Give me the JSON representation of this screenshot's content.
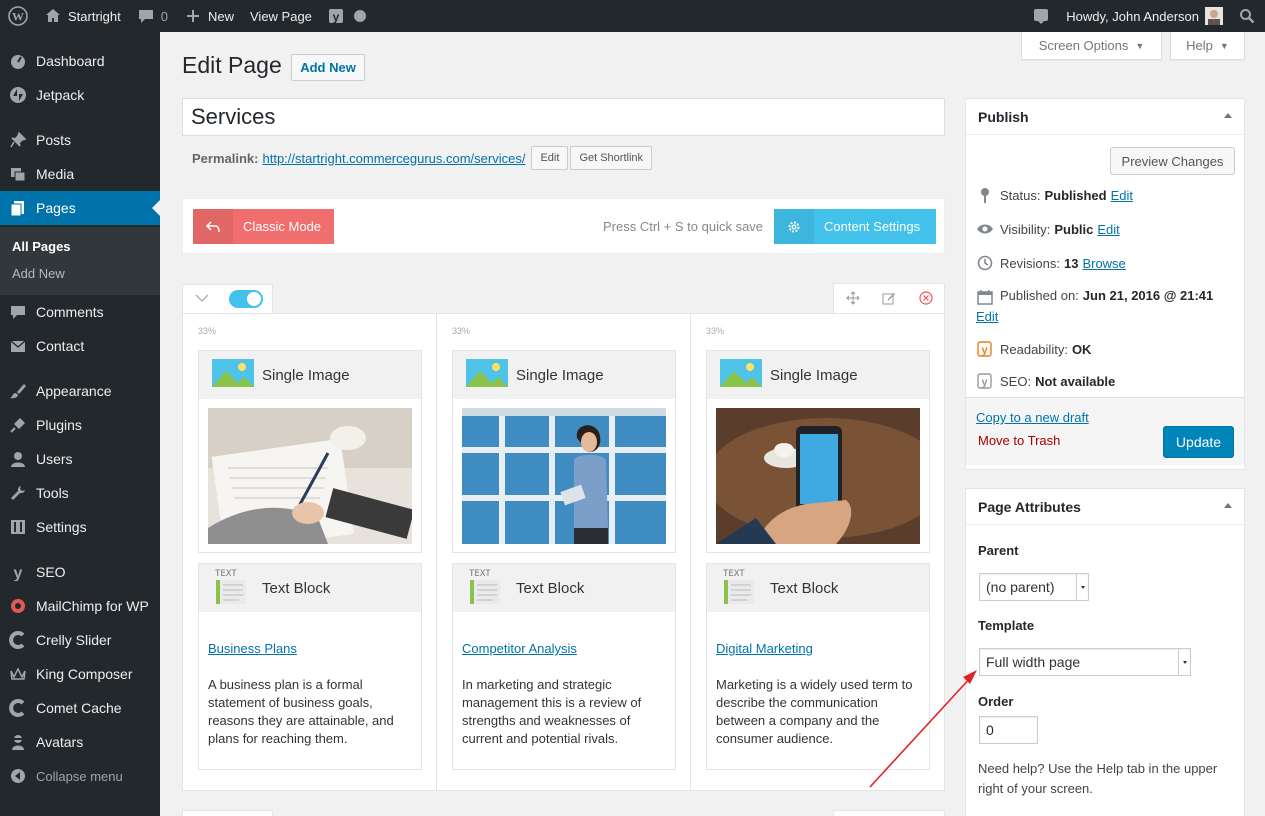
{
  "adminbar": {
    "site_name": "Startright",
    "comments_count": "0",
    "new_label": "New",
    "view_page": "View Page",
    "howdy": "Howdy, John Anderson"
  },
  "sidebar": {
    "items": [
      {
        "label": "Dashboard",
        "icon": "dashboard-icon"
      },
      {
        "label": "Jetpack",
        "icon": "jetpack-icon"
      },
      {
        "label": "Posts",
        "icon": "pin-icon"
      },
      {
        "label": "Media",
        "icon": "media-icon"
      },
      {
        "label": "Pages",
        "icon": "pages-icon"
      },
      {
        "label": "Comments",
        "icon": "comment-icon"
      },
      {
        "label": "Contact",
        "icon": "mail-icon"
      },
      {
        "label": "Appearance",
        "icon": "brush-icon"
      },
      {
        "label": "Plugins",
        "icon": "plugin-icon"
      },
      {
        "label": "Users",
        "icon": "user-icon"
      },
      {
        "label": "Tools",
        "icon": "wrench-icon"
      },
      {
        "label": "Settings",
        "icon": "settings-icon"
      },
      {
        "label": "SEO",
        "icon": "yoast-icon"
      },
      {
        "label": "MailChimp for WP",
        "icon": "mailchimp-icon"
      },
      {
        "label": "Crelly Slider",
        "icon": "slider-icon"
      },
      {
        "label": "King Composer",
        "icon": "crown-icon"
      },
      {
        "label": "Comet Cache",
        "icon": "comet-icon"
      },
      {
        "label": "Avatars",
        "icon": "avatar-icon"
      },
      {
        "label": "Collapse menu",
        "icon": "collapse-icon"
      }
    ],
    "submenu": {
      "all_pages": "All Pages",
      "add_new": "Add New"
    }
  },
  "screen_options": "Screen Options",
  "help": "Help",
  "page": {
    "heading": "Edit Page",
    "add_new": "Add New",
    "title": "Services",
    "permalink_label": "Permalink:",
    "permalink_url": "http://startright.commercegurus.com/services/",
    "edit_btn": "Edit",
    "shortlink_btn": "Get Shortlink"
  },
  "composer": {
    "classic_mode": "Classic Mode",
    "quick_save": "Press Ctrl + S to quick save",
    "content_settings": "Content Settings",
    "columns": [
      {
        "width": "33%",
        "image_label": "Single Image",
        "text_label": "Text Block",
        "link": "Business Plans",
        "text": "A business plan is a formal statement of business goals, reasons they are attainable, and plans for reaching them."
      },
      {
        "width": "33%",
        "image_label": "Single Image",
        "text_label": "Text Block",
        "link": "Competitor Analysis",
        "text": "In marketing and strategic management this is a review of strengths and weaknesses of current and potential rivals."
      },
      {
        "width": "33%",
        "image_label": "Single Image",
        "text_label": "Text Block",
        "link": "Digital Marketing",
        "text": "Marketing is a widely used term to describe the communication between a company and the consumer audience."
      }
    ]
  },
  "publish": {
    "title": "Publish",
    "preview": "Preview Changes",
    "status_label": "Status:",
    "status_value": "Published",
    "visibility_label": "Visibility:",
    "visibility_value": "Public",
    "revisions_label": "Revisions:",
    "revisions_value": "13",
    "browse": "Browse",
    "published_label": "Published on:",
    "published_value": "Jun 21, 2016 @ 21:41",
    "edit": "Edit",
    "readability_label": "Readability:",
    "readability_value": "OK",
    "seo_label": "SEO:",
    "seo_value": "Not available",
    "copy_draft": "Copy to a new draft",
    "trash": "Move to Trash",
    "update": "Update"
  },
  "attributes": {
    "title": "Page Attributes",
    "parent_label": "Parent",
    "parent_value": "(no parent)",
    "template_label": "Template",
    "template_value": "Full width page",
    "order_label": "Order",
    "order_value": "0",
    "help": "Need help? Use the Help tab in the upper right of your screen."
  },
  "colors": {
    "wp_blue": "#0073aa",
    "admin_dark": "#23282d",
    "classic_red": "#f06e6e",
    "kc_blue": "#42c1ea",
    "annotation": "#e02424"
  }
}
